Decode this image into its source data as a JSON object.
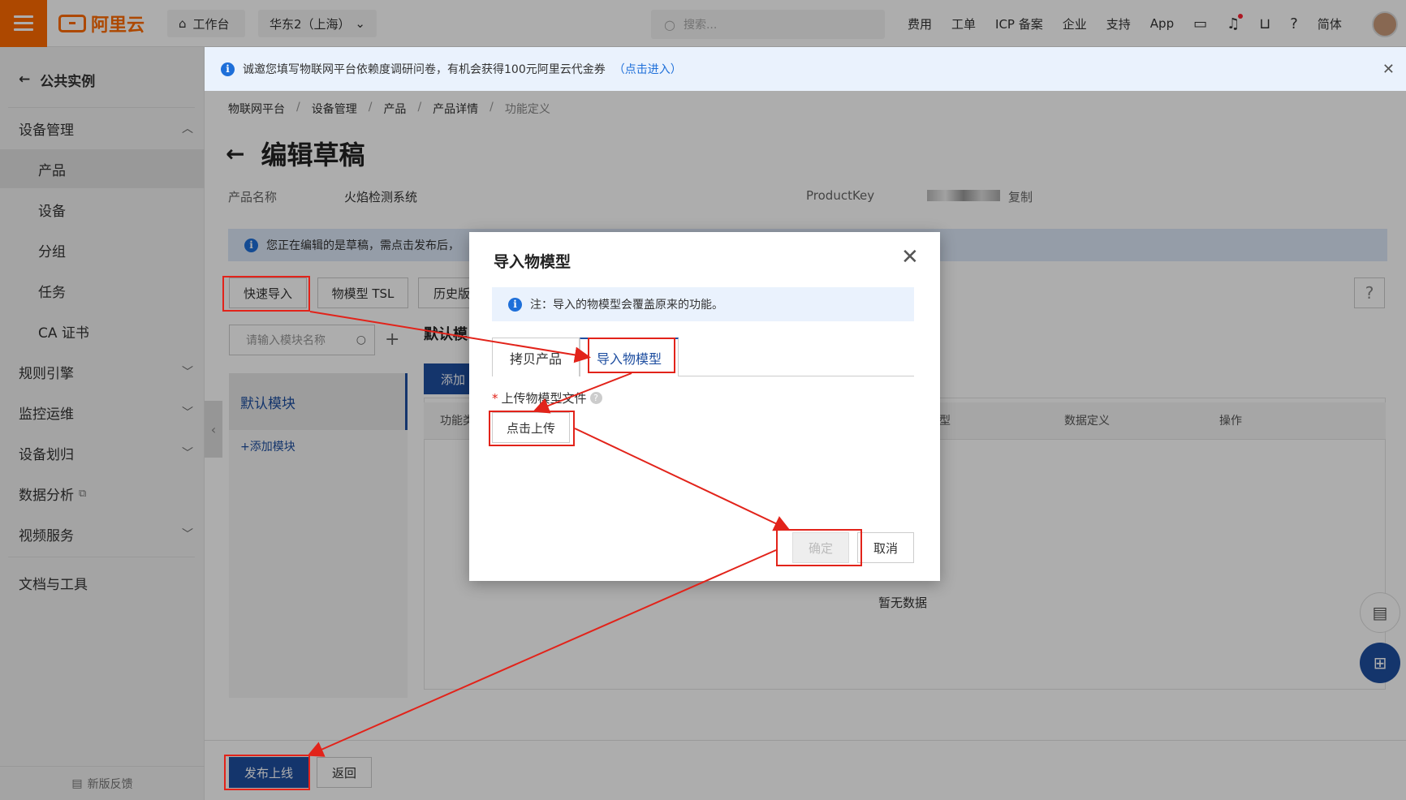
{
  "topbar": {
    "logo_text": "阿里云",
    "workbench": "工作台",
    "region": "华东2（上海）",
    "search_placeholder": "搜索...",
    "links": [
      "费用",
      "工单",
      "ICP 备案",
      "企业",
      "支持",
      "App"
    ],
    "lang": "简体"
  },
  "sidebar": {
    "back_label": "公共实例",
    "group_device": "设备管理",
    "items": [
      "产品",
      "设备",
      "分组",
      "任务",
      "CA 证书"
    ],
    "groups": [
      "规则引擎",
      "监控运维",
      "设备划归",
      "数据分析",
      "视频服务"
    ],
    "docs": "文档与工具",
    "feedback": "新版反馈"
  },
  "notice": {
    "text": "诚邀您填写物联网平台依赖度调研问卷，有机会获得100元阿里云代金券",
    "link": "（点击进入）"
  },
  "breadcrumb": [
    "物联网平台",
    "设备管理",
    "产品",
    "产品详情",
    "功能定义"
  ],
  "page": {
    "title": "编辑草稿",
    "product_name_label": "产品名称",
    "product_name": "火焰检测系统",
    "productkey_label": "ProductKey",
    "copy": "复制",
    "edit_notice": "您正在编辑的是草稿，需点击发布后，",
    "quick_import": "快速导入",
    "tsl": "物模型 TSL",
    "history": "历史版",
    "module_search_placeholder": "请输入模块名称",
    "default_module": "默认模块",
    "default_module_heading": "默认模",
    "add_module": "+添加模块",
    "add_button": "添加",
    "col_function": "功能类",
    "col_type": "型",
    "col_data_def": "数据定义",
    "col_ops": "操作",
    "empty": "暂无数据",
    "publish": "发布上线",
    "back": "返回"
  },
  "modal": {
    "title": "导入物模型",
    "note": "注：导入的物模型会覆盖原来的功能。",
    "tab_copy": "拷贝产品",
    "tab_import": "导入物模型",
    "upload_label": "上传物模型文件",
    "upload_button": "点击上传",
    "confirm": "确定",
    "cancel": "取消"
  },
  "colors": {
    "brand": "#ff6a00",
    "primary": "#1e4ea0",
    "annotation": "#e2231a"
  }
}
